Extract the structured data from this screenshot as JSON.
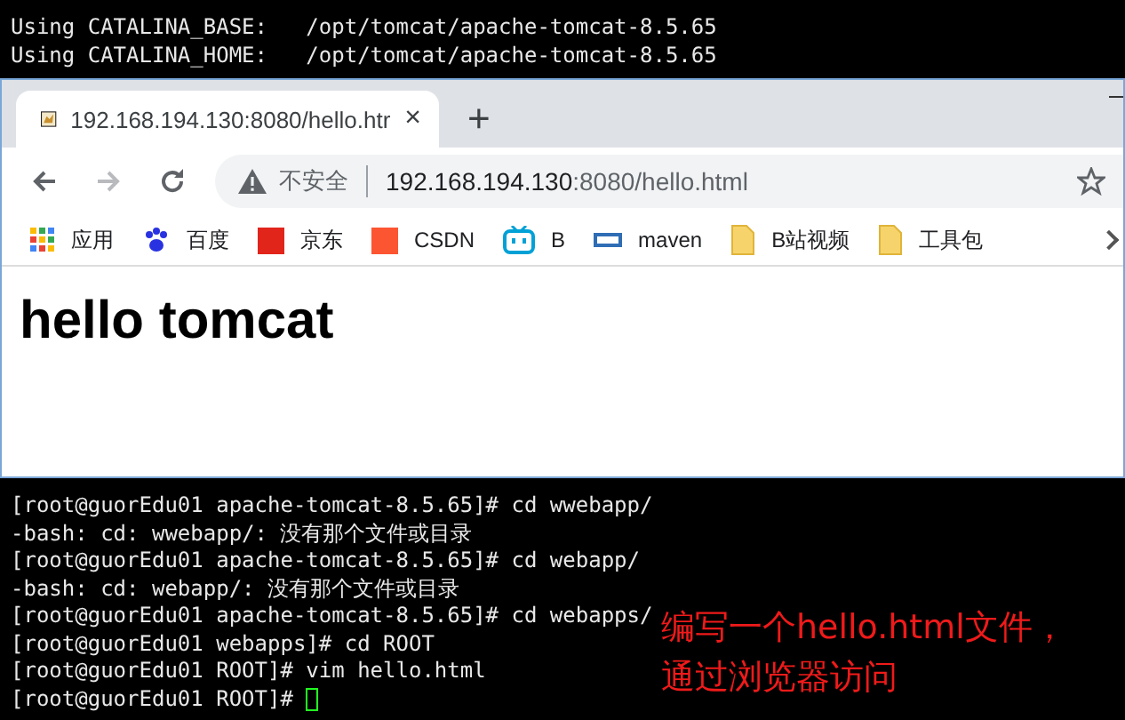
{
  "terminal_top": {
    "lines": [
      "Using CATALINA_BASE:   /opt/tomcat/apache-tomcat-8.5.65",
      "Using CATALINA_HOME:   /opt/tomcat/apache-tomcat-8.5.65"
    ]
  },
  "browser": {
    "tab": {
      "title": "192.168.194.130:8080/hello.htr",
      "close": "×",
      "selected": true
    },
    "new_tab": "+",
    "address": {
      "security": "不安全",
      "host": "192.168.194.130",
      "rest": ":8080/hello.html"
    },
    "bookmarks": [
      {
        "kind": "apps",
        "label": "应用"
      },
      {
        "kind": "baidu",
        "label": "百度"
      },
      {
        "kind": "jd",
        "label": "京东"
      },
      {
        "kind": "csdn",
        "label": "CSDN"
      },
      {
        "kind": "bili",
        "label": "B"
      },
      {
        "kind": "mvn",
        "label": "maven"
      },
      {
        "kind": "folder",
        "label": "B站视频"
      },
      {
        "kind": "folder",
        "label": "工具包"
      }
    ],
    "heading": "hello tomcat"
  },
  "terminal_bottom": {
    "lines": [
      "[root@guorEdu01 apache-tomcat-8.5.65]# cd wwebapp/",
      "-bash: cd: wwebapp/: 没有那个文件或目录",
      "[root@guorEdu01 apache-tomcat-8.5.65]# cd webapp/",
      "-bash: cd: webapp/: 没有那个文件或目录",
      "[root@guorEdu01 apache-tomcat-8.5.65]# cd webapps/",
      "[root@guorEdu01 webapps]# cd ROOT",
      "[root@guorEdu01 ROOT]# vim hello.html",
      "[root@guorEdu01 ROOT]# "
    ]
  },
  "annotation": [
    "编写一个hello.html文件，",
    "通过浏览器访问"
  ]
}
